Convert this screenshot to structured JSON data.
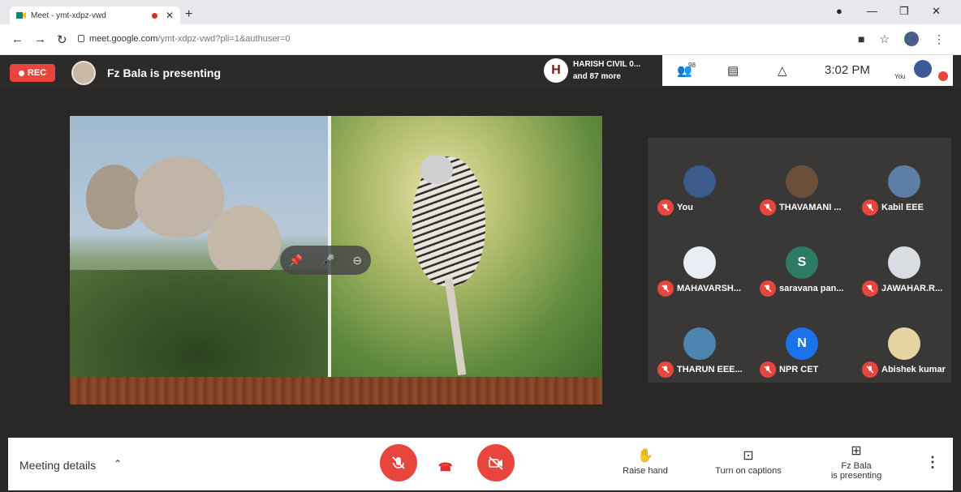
{
  "browser": {
    "tab_title": "Meet - ymt-xdpz-vwd",
    "url_host": "meet.google.com",
    "url_path": "/ymt-xdpz-vwd?pli=1&authuser=0"
  },
  "meet": {
    "rec_label": "REC",
    "presenting_text": "Fz Bala is presenting",
    "harish_initial": "H",
    "harish_line1": "HARISH CIVIL 0...",
    "harish_line2": "and 87 more",
    "people_count": "98",
    "clock": "3:02 PM",
    "you_label": "You"
  },
  "participants": [
    {
      "name": "You",
      "initial": ""
    },
    {
      "name": "THAVAMANI ...",
      "initial": ""
    },
    {
      "name": "Kabil EEE",
      "initial": ""
    },
    {
      "name": "MAHAVARSH...",
      "initial": ""
    },
    {
      "name": "saravana pan...",
      "initial": "S"
    },
    {
      "name": "JAWAHAR.R...",
      "initial": ""
    },
    {
      "name": "THARUN EEE...",
      "initial": ""
    },
    {
      "name": "NPR CET",
      "initial": "N"
    },
    {
      "name": "Abishek kumar",
      "initial": ""
    }
  ],
  "bottom_bar": {
    "meeting_details": "Meeting details",
    "raise_hand": "Raise hand",
    "captions": "Turn on captions",
    "presenting_line1": "Fz Bala",
    "presenting_line2": "is presenting"
  },
  "colors": {
    "accent_red": "#e8453c",
    "top_bar": "#2c2b2a",
    "tile_bg": "#3a3836"
  }
}
